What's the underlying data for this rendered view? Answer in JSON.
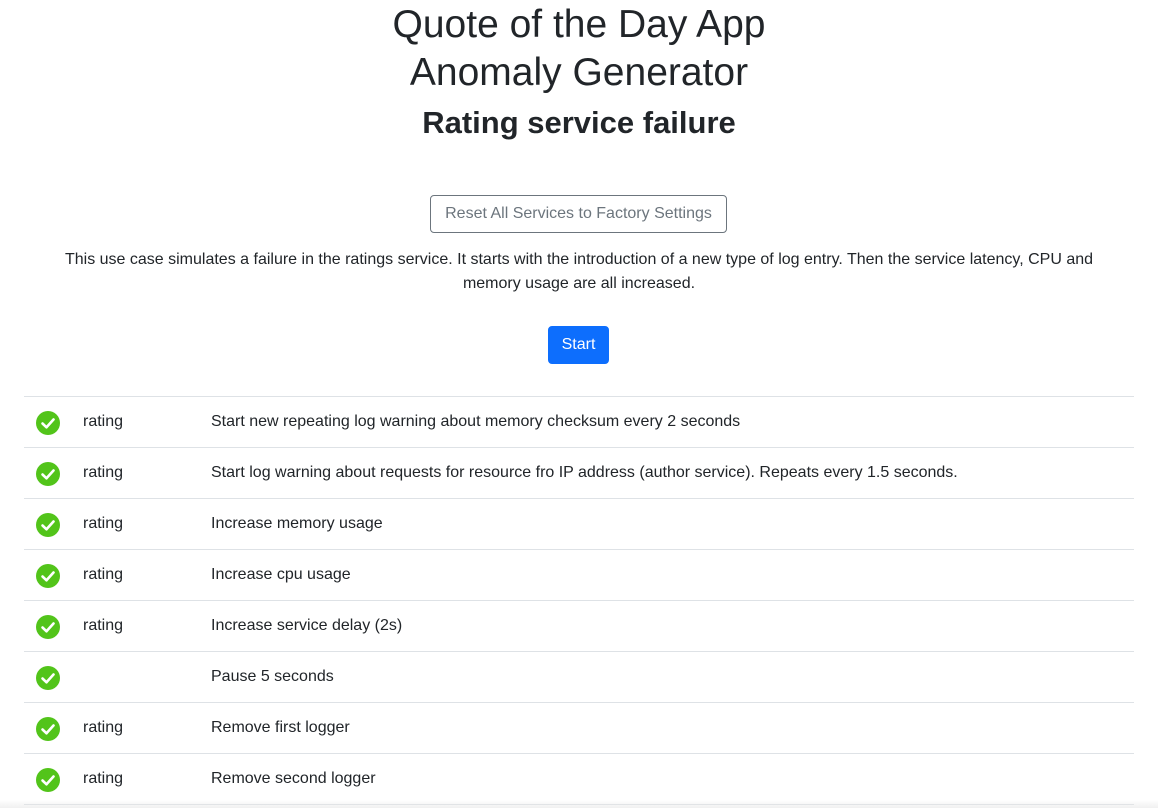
{
  "header": {
    "title_line1": "Quote of the Day App",
    "title_line2": "Anomaly Generator",
    "subtitle": "Rating service failure"
  },
  "reset_button_label": "Reset All Services to Factory Settings",
  "description": "This use case simulates a failure in the ratings service. It starts with the introduction of a new type of log entry. Then the service latency, CPU and memory usage are all increased.",
  "start_button_label": "Start",
  "status_colors": {
    "complete": "#52c41a"
  },
  "steps": [
    {
      "status": "complete",
      "icon": "check-circle-icon",
      "service": "rating",
      "action": "Start new repeating log warning about memory checksum every 2 seconds"
    },
    {
      "status": "complete",
      "icon": "check-circle-icon",
      "service": "rating",
      "action": "Start log warning about requests for resource fro IP address (author service). Repeats every 1.5 seconds."
    },
    {
      "status": "complete",
      "icon": "check-circle-icon",
      "service": "rating",
      "action": "Increase memory usage"
    },
    {
      "status": "complete",
      "icon": "check-circle-icon",
      "service": "rating",
      "action": "Increase cpu usage"
    },
    {
      "status": "complete",
      "icon": "check-circle-icon",
      "service": "rating",
      "action": "Increase service delay (2s)"
    },
    {
      "status": "complete",
      "icon": "check-circle-icon",
      "service": "",
      "action": "Pause 5 seconds"
    },
    {
      "status": "complete",
      "icon": "check-circle-icon",
      "service": "rating",
      "action": "Remove first logger"
    },
    {
      "status": "complete",
      "icon": "check-circle-icon",
      "service": "rating",
      "action": "Remove second logger"
    }
  ]
}
